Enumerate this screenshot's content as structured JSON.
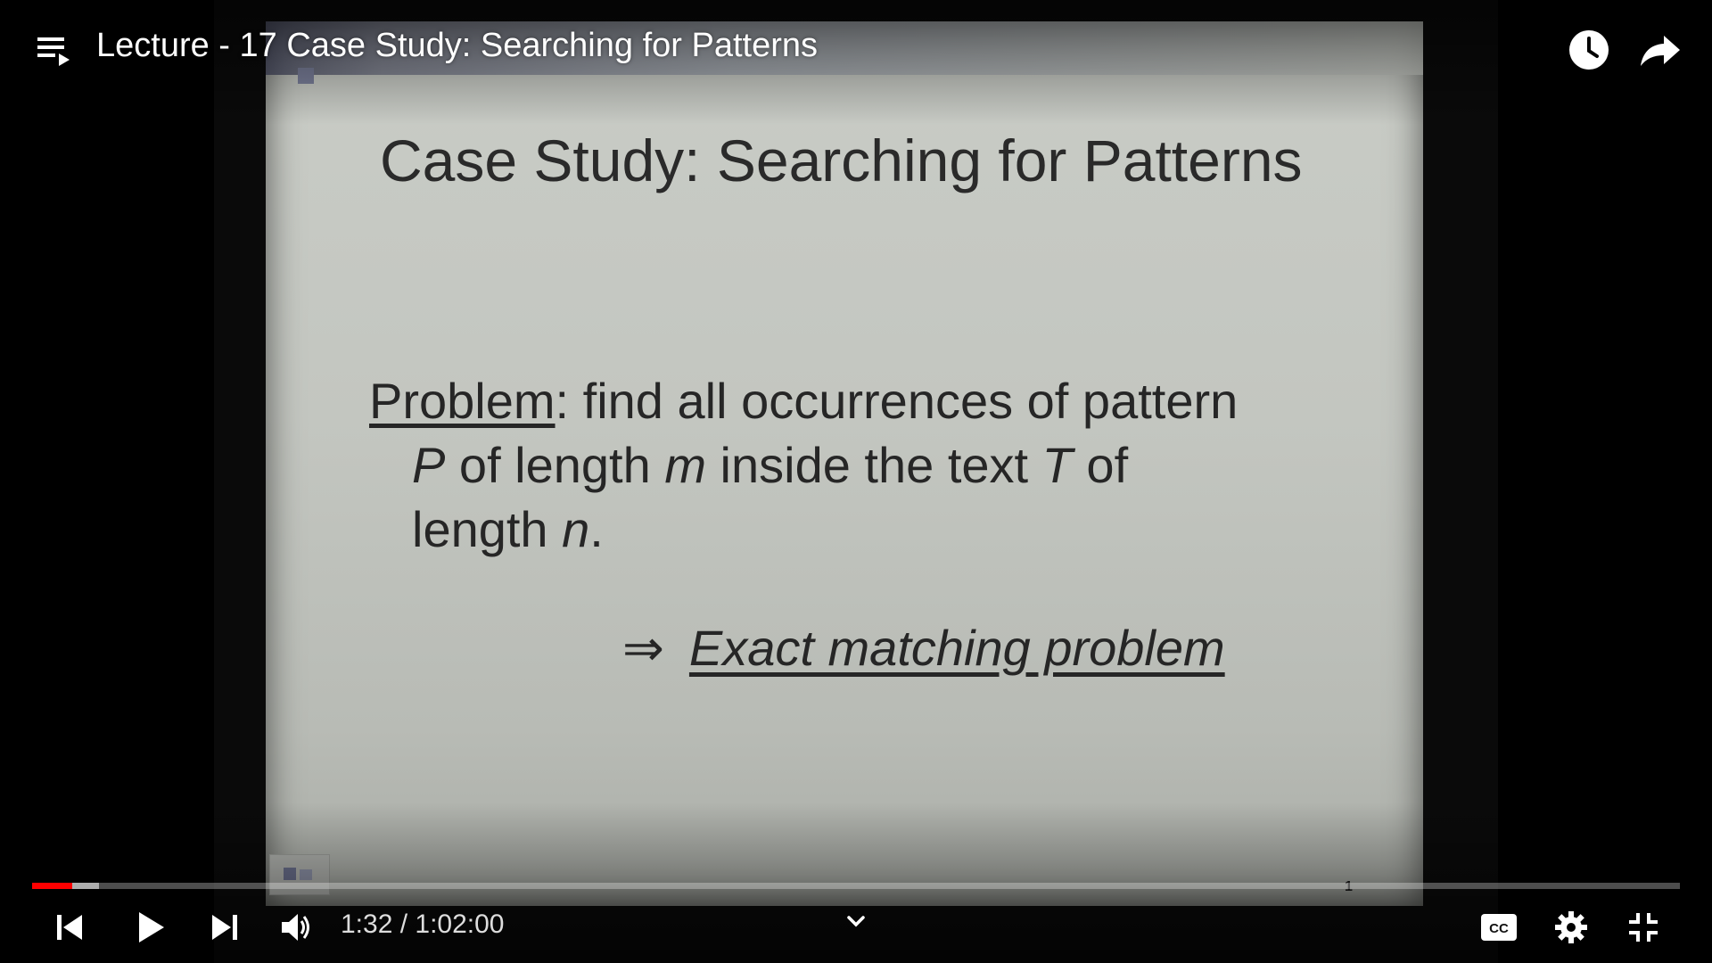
{
  "header": {
    "title": "Lecture - 17 Case Study: Searching for Patterns"
  },
  "slide": {
    "title": "Case Study: Searching for Patterns",
    "problem_label": "Problem",
    "line1_rest": ": find all occurrences of pattern",
    "line2_p": "P",
    "line2_mid": " of length ",
    "line2_m": "m",
    "line2_mid2": " inside the text ",
    "line2_t": "T",
    "line2_end": " of",
    "line3_start": "length ",
    "line3_n": "n",
    "line3_end": ".",
    "arrow": "⇒",
    "conclusion": "Exact matching problem",
    "page_number": "1"
  },
  "controls": {
    "time": "1:32 / 1:02:00",
    "progress_played": 0.0243,
    "progress_buffered": 0.0405
  },
  "icons": {
    "playlist": "playlist-icon",
    "watch_later": "clock-icon",
    "share": "share-icon",
    "previous": "skip-previous-icon",
    "play": "play-icon",
    "next": "skip-next-icon",
    "volume": "volume-icon",
    "expand": "chevron-down-icon",
    "captions": "cc-icon",
    "settings": "gear-icon",
    "exit_fullscreen": "exit-fullscreen-icon"
  },
  "colors": {
    "progress_played": "#ff0000",
    "controls": "#ffffff"
  }
}
